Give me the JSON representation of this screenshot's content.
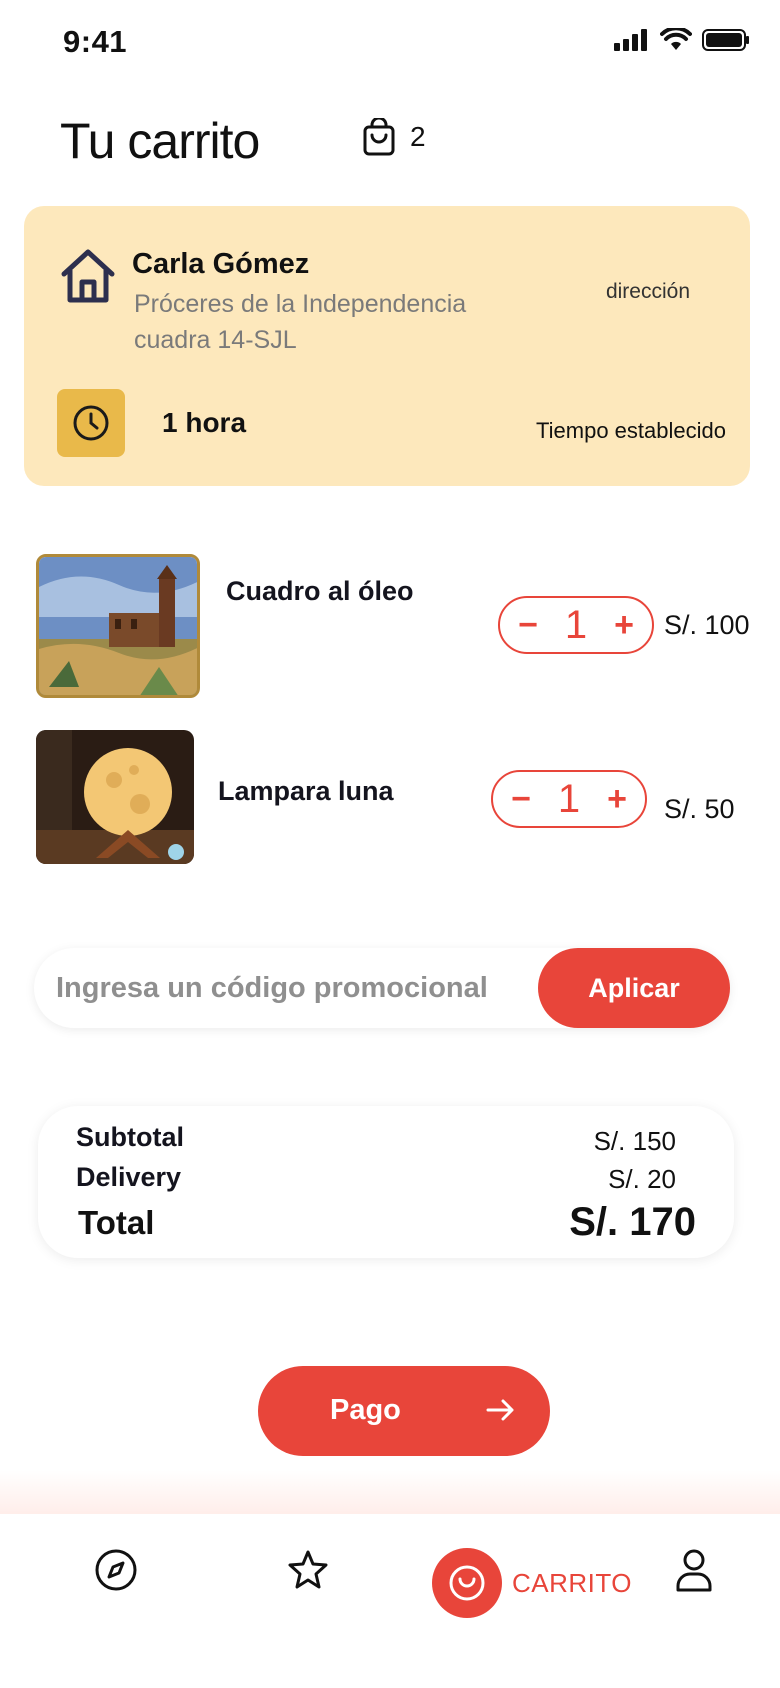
{
  "status": {
    "time": "9:41"
  },
  "header": {
    "title": "Tu carrito",
    "cart_count": "2"
  },
  "address": {
    "name": "Carla Gómez",
    "line": "Próceres de la Independencia cuadra 14-SJL",
    "link_label": "dirección",
    "time_value": "1 hora",
    "time_label": "Tiempo establecido"
  },
  "items": [
    {
      "name": "Cuadro al óleo",
      "qty": "1",
      "price": "S/. 100",
      "minus": "−",
      "plus": "+"
    },
    {
      "name": "Lampara luna",
      "qty": "1",
      "price": "S/. 50",
      "minus": "−",
      "plus": "+"
    }
  ],
  "promo": {
    "placeholder": "Ingresa un código promocional",
    "apply_label": "Aplicar"
  },
  "summary": {
    "subtotal_label": "Subtotal",
    "subtotal_value": "S/. 150",
    "delivery_label": "Delivery",
    "delivery_value": "S/. 20",
    "total_label": "Total",
    "total_value": "S/. 170"
  },
  "checkout": {
    "label": "Pago"
  },
  "tabbar": {
    "active_label": "CARRITO"
  },
  "colors": {
    "accent": "#e8453a",
    "card": "#fde8bc",
    "clock": "#e9b94a"
  }
}
